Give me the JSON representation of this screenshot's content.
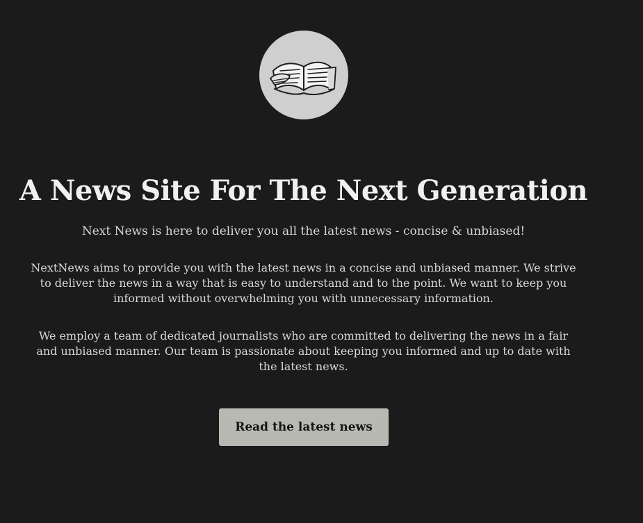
{
  "logo": {
    "icon": "newspaper-icon",
    "background": "#cfcfcf"
  },
  "hero": {
    "title": "A News Site For The Next Generation",
    "tagline": "Next News is here to deliver you all the latest news - concise & unbiased!",
    "paragraphs": [
      "NextNews aims to provide you with the latest news in a concise and unbiased manner. We strive to deliver the news in a way that is easy to understand and to the point. We want to keep you informed without overwhelming you with unnecessary information.",
      "We employ a team of dedicated journalists who are committed to delivering the news in a fair and unbiased manner. Our team is passionate about keeping you informed and up to date with the latest news."
    ],
    "cta_label": "Read the latest news"
  },
  "colors": {
    "background": "#1b1b1b",
    "text": "#e6e6e6",
    "button_background": "#b9b9b3",
    "button_text": "#151515"
  }
}
